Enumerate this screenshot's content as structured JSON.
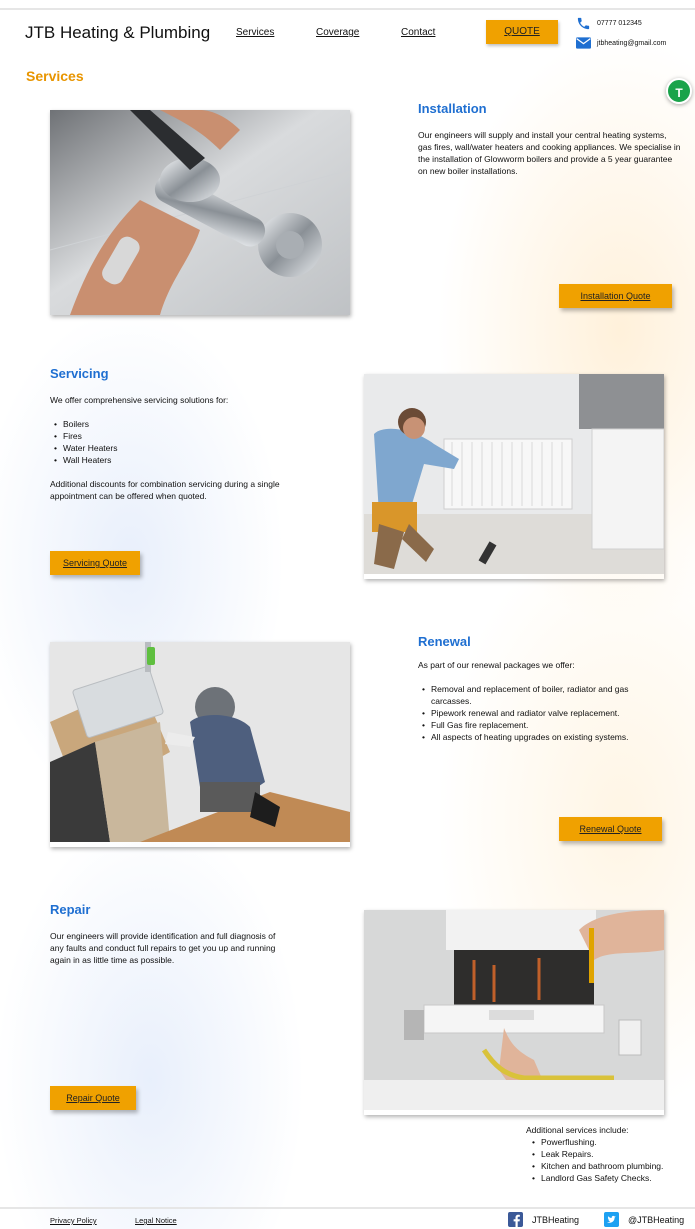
{
  "header": {
    "brand": "JTB Heating & Plumbing",
    "nav": [
      "Services",
      "Coverage",
      "Contact"
    ],
    "quote_label": "QUOTE",
    "phone": "07777 012345",
    "email": "jtbheating@gmail.com"
  },
  "page": {
    "title": "Services",
    "avatar_letter": "T"
  },
  "sections": [
    {
      "title": "Installation",
      "body": "Our engineers will supply and install your central heating systems, gas fires, wall/water heaters and cooking appliances. We specialise in the installation of Glowworm boilers and provide a 5 year guarantee on new boiler installations.",
      "button": "Installation Quote"
    },
    {
      "title": "Servicing",
      "intro": "We offer comprehensive servicing solutions for:",
      "items": [
        "Boilers",
        "Fires",
        "Water Heaters",
        "Wall Heaters"
      ],
      "outro": "Additional discounts for combination servicing during a single appointment can be offered when quoted.",
      "button": "Servicing Quote"
    },
    {
      "title": "Renewal",
      "intro": "As part of our renewal packages we offer:",
      "items": [
        "Removal and replacement of boiler, radiator and gas carcasses.",
        "Pipework renewal and radiator valve replacement.",
        "Full Gas fire replacement.",
        "All aspects of heating upgrades on existing systems."
      ],
      "button": "Renewal Quote"
    },
    {
      "title": "Repair",
      "body": "Our engineers will provide identification and full diagnosis of any faults and conduct full repairs to get you up and running again in as little time as possible.",
      "button": "Repair Quote"
    }
  ],
  "additional": {
    "heading": "Additional services include:",
    "items": [
      "Powerflushing.",
      "Leak Repairs.",
      "Kitchen and bathroom plumbing.",
      "Landlord Gas Safety Checks."
    ]
  },
  "footer": {
    "privacy": "Privacy Policy",
    "legal": "Legal Notice",
    "facebook": "JTBHeating",
    "twitter": "@JTBHeating"
  },
  "colors": {
    "accent": "#f0a100",
    "title_orange": "#e89500",
    "section_blue": "#1f6fd1",
    "avatar_green": "#1aa34a",
    "facebook_blue": "#3b5998",
    "twitter_blue": "#1da1f2"
  },
  "icons": [
    "phone-icon",
    "mail-icon",
    "facebook-icon",
    "twitter-icon"
  ]
}
